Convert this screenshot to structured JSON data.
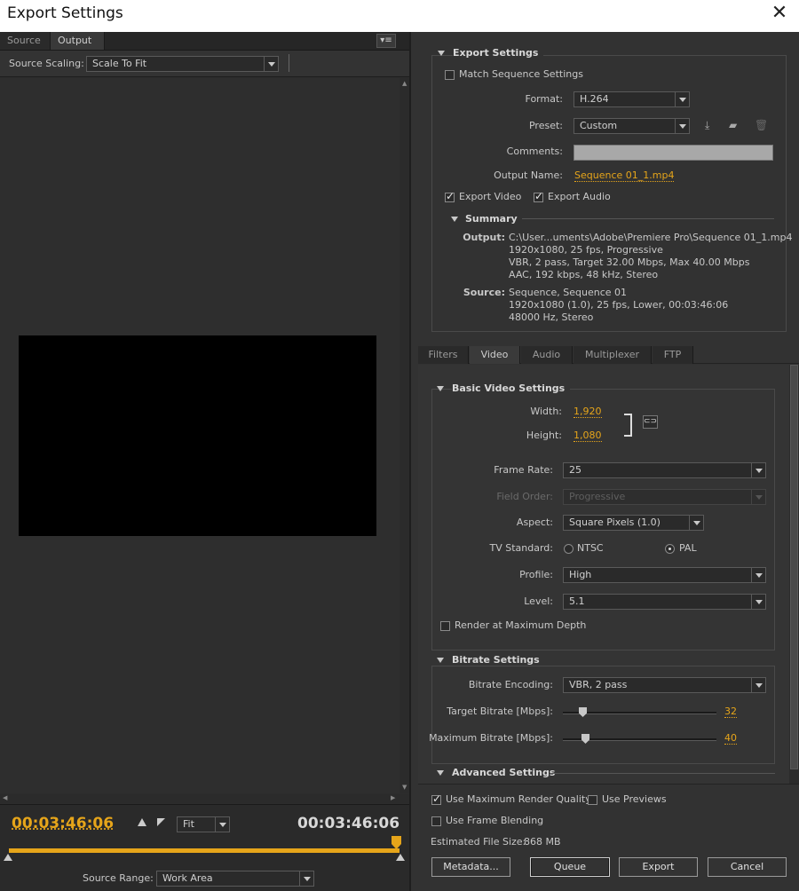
{
  "window": {
    "title": "Export Settings",
    "close_icon": "close-icon"
  },
  "left": {
    "tabs": [
      "Source",
      "Output"
    ],
    "active_tab": "Output",
    "source_scaling": {
      "label": "Source Scaling:",
      "value": "Scale To Fit"
    },
    "timecode_current": "00:03:46:06",
    "timecode_end": "00:03:46:06",
    "zoom": "Fit",
    "source_range": {
      "label": "Source Range:",
      "value": "Work Area"
    }
  },
  "export": {
    "header": "Export Settings",
    "match_sequence": "Match Sequence Settings",
    "format_label": "Format:",
    "format": "H.264",
    "preset_label": "Preset:",
    "preset": "Custom",
    "comments_label": "Comments:",
    "output_name_label": "Output Name:",
    "output_name": "Sequence 01_1.mp4",
    "export_video": "Export Video",
    "export_audio": "Export Audio",
    "summary": {
      "header": "Summary",
      "output_label": "Output:",
      "output_lines": [
        "C:\\User...uments\\Adobe\\Premiere Pro\\Sequence 01_1.mp4",
        "1920x1080, 25 fps, Progressive",
        "VBR, 2 pass, Target 32.00 Mbps, Max 40.00 Mbps",
        "AAC, 192 kbps, 48 kHz, Stereo"
      ],
      "source_label": "Source:",
      "source_lines": [
        "Sequence, Sequence 01",
        "1920x1080 (1.0), 25 fps, Lower, 00:03:46:06",
        "48000 Hz, Stereo"
      ]
    }
  },
  "tabs": [
    "Filters",
    "Video",
    "Audio",
    "Multiplexer",
    "FTP"
  ],
  "active_tab": "Video",
  "video": {
    "basic_header": "Basic Video Settings",
    "width_label": "Width:",
    "width": "1,920",
    "height_label": "Height:",
    "height": "1,080",
    "frame_rate_label": "Frame Rate:",
    "frame_rate": "25",
    "field_order_label": "Field Order:",
    "field_order": "Progressive",
    "aspect_label": "Aspect:",
    "aspect": "Square Pixels (1.0)",
    "tv_standard_label": "TV Standard:",
    "ntsc": "NTSC",
    "pal": "PAL",
    "profile_label": "Profile:",
    "profile": "High",
    "level_label": "Level:",
    "level": "5.1",
    "render_max_depth": "Render at Maximum Depth",
    "bitrate_header": "Bitrate Settings",
    "bitrate_encoding_label": "Bitrate Encoding:",
    "bitrate_encoding": "VBR, 2 pass",
    "target_bitrate_label": "Target Bitrate [Mbps]:",
    "target_bitrate": "32",
    "max_bitrate_label": "Maximum Bitrate [Mbps]:",
    "max_bitrate": "40",
    "advanced_header": "Advanced Settings"
  },
  "bottom": {
    "use_max_render": "Use Maximum Render Quality",
    "use_previews": "Use Previews",
    "use_frame_blending": "Use Frame Blending",
    "estimated_label": "Estimated File Size:",
    "estimated": "868 MB",
    "metadata": "Metadata...",
    "queue": "Queue",
    "export": "Export",
    "cancel": "Cancel"
  },
  "colors": {
    "accent": "#e6a51a",
    "bg": "#323232"
  }
}
